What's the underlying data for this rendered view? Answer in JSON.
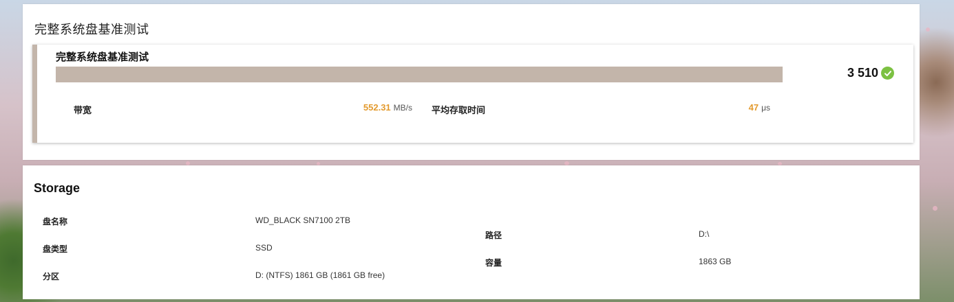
{
  "benchmark_panel": {
    "title": "完整系统盘基准测试",
    "card": {
      "title": "完整系统盘基准测试",
      "progress_fraction": 1.0,
      "progress_color": "#c3b5aa",
      "score": "3 510",
      "score_icon": "check-circle-icon",
      "score_icon_color": "#7cc142",
      "bandwidth": {
        "label": "带宽",
        "value": "552.31",
        "unit": "MB/s"
      },
      "access_time": {
        "label": "平均存取时间",
        "value": "47",
        "unit": "μs"
      },
      "accent_color": "#e39a2d"
    }
  },
  "storage_panel": {
    "title": "Storage",
    "rows_left": [
      {
        "label": "盘名称",
        "value": "WD_BLACK SN7100 2TB"
      },
      {
        "label": "盘类型",
        "value": "SSD"
      },
      {
        "label": "分区",
        "value": "D: (NTFS) 1861 GB (1861 GB free)"
      }
    ],
    "rows_right": [
      {
        "label": "路径",
        "value": "D:\\"
      },
      {
        "label": "容量",
        "value": "1863 GB"
      }
    ]
  }
}
